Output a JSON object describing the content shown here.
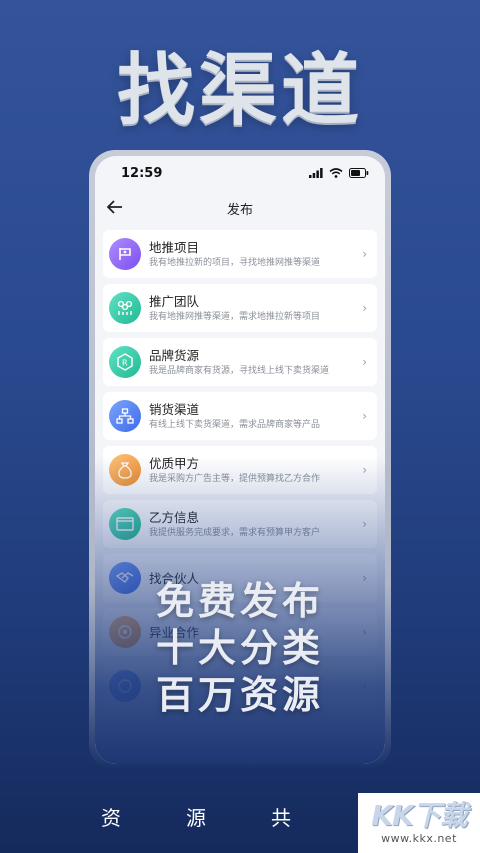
{
  "hero": {
    "title": "找渠道"
  },
  "status_bar": {
    "time": "12:59"
  },
  "nav": {
    "title": "发布"
  },
  "items": [
    {
      "title": "地推项目",
      "desc": "我有地推拉新的项目，寻找地推网推等渠道",
      "icon": "flag-icon",
      "color": "#8a5cf0"
    },
    {
      "title": "推广团队",
      "desc": "我有地推网推等渠道，需求地推拉新等项目",
      "icon": "team-icon",
      "color": "#2bc9a6"
    },
    {
      "title": "品牌货源",
      "desc": "我是品牌商家有货源，寻找线上线下卖货渠道",
      "icon": "brand-icon",
      "color": "#2bc9a6"
    },
    {
      "title": "销货渠道",
      "desc": "有线上线下卖货渠道，需求品牌商家等产品",
      "icon": "network-icon",
      "color": "#4a7bf0"
    },
    {
      "title": "优质甲方",
      "desc": "我是采购方广告主等，提供预算找乙方合作",
      "icon": "moneybag-icon",
      "color": "#f0a23c"
    },
    {
      "title": "乙方信息",
      "desc": "我提供服务完成要求，需求有预算甲方客户",
      "icon": "folder-icon",
      "color": "#2bc9a6"
    },
    {
      "title": "找合伙人",
      "desc": "",
      "icon": "handshake-icon",
      "color": "#4a7bf0"
    },
    {
      "title": "异业合作",
      "desc": "",
      "icon": "cooperation-icon",
      "color": "#f0a23c"
    },
    {
      "title": "",
      "desc": "",
      "icon": "circle-icon",
      "color": "#4a7bf0"
    }
  ],
  "slogans": [
    "免费发布",
    "十大分类",
    "百万资源"
  ],
  "bottom_chars": [
    "资",
    "源",
    "共"
  ],
  "watermark": {
    "logo": "KK下载",
    "url": "www.kkx.net"
  }
}
